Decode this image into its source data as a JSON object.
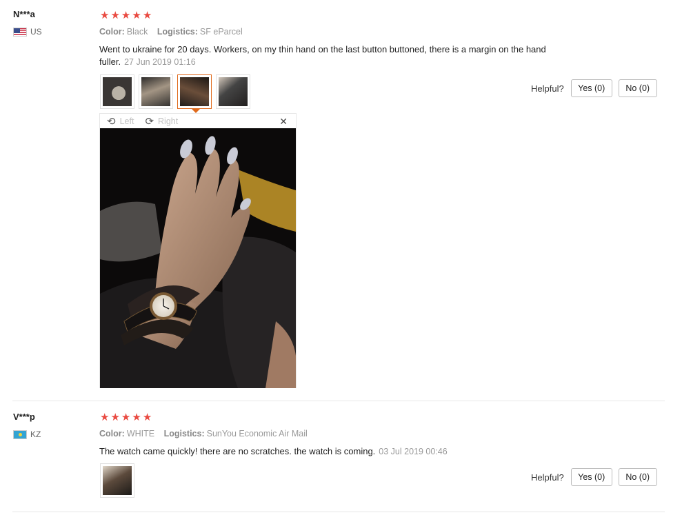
{
  "reviews": [
    {
      "user": "N***a",
      "country": "US",
      "rating": 5,
      "color_label": "Color:",
      "color_value": "Black",
      "logistics_label": "Logistics:",
      "logistics_value": "SF eParcel",
      "text": "Went to ukraine for 20 days. Workers, on my thin hand on the last button buttoned, there is a margin on the hand fuller.",
      "date": "27 Jun 2019 01:16",
      "helpful_label": "Helpful?",
      "yes_label": "Yes (0)",
      "no_label": "No (0)",
      "viewer": {
        "rotate_left": "Left",
        "rotate_right": "Right",
        "close": "✕"
      }
    },
    {
      "user": "V***p",
      "country": "KZ",
      "rating": 5,
      "color_label": "Color:",
      "color_value": "WHITE",
      "logistics_label": "Logistics:",
      "logistics_value": "SunYou Economic Air Mail",
      "text": "The watch came quickly! there are no scratches. the watch is coming.",
      "date": "03 Jul 2019 00:46",
      "helpful_label": "Helpful?",
      "yes_label": "Yes (0)",
      "no_label": "No (0)"
    }
  ],
  "icons": {
    "star": "star-icon",
    "rotate_left": "rotate-left-icon",
    "rotate_right": "rotate-right-icon",
    "close": "close-icon"
  },
  "colors": {
    "star": "#e94a41",
    "active_thumb": "#e06a1c"
  }
}
